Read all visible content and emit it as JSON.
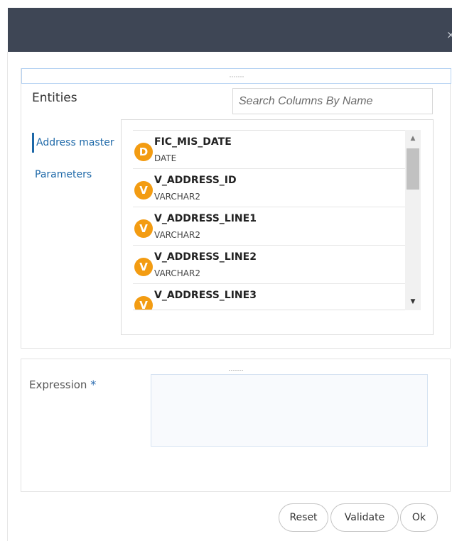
{
  "dialog": {
    "close_label": "×"
  },
  "entities": {
    "title": "Entities",
    "search_placeholder": "Search Columns By Name",
    "nav": [
      {
        "label": "Address master",
        "active": true
      },
      {
        "label": "Parameters",
        "active": false
      }
    ]
  },
  "columns": [
    {
      "badge": "D",
      "name": "FIC_MIS_DATE",
      "type": "DATE"
    },
    {
      "badge": "V",
      "name": "V_ADDRESS_ID",
      "type": "VARCHAR2"
    },
    {
      "badge": "V",
      "name": "V_ADDRESS_LINE1",
      "type": "VARCHAR2"
    },
    {
      "badge": "V",
      "name": "V_ADDRESS_LINE2",
      "type": "VARCHAR2"
    },
    {
      "badge": "V",
      "name": "V_ADDRESS_LINE3",
      "type": ""
    }
  ],
  "scrollbar": {
    "up_icon": "▲",
    "down_icon": "▼"
  },
  "expression": {
    "label": "Expression",
    "required_mark": "*",
    "value": ""
  },
  "buttons": {
    "reset": "Reset",
    "validate": "Validate",
    "ok": "Ok"
  },
  "colors": {
    "titlebar": "#3e4655",
    "badge": "#f39c12",
    "link": "#1d68a8"
  }
}
